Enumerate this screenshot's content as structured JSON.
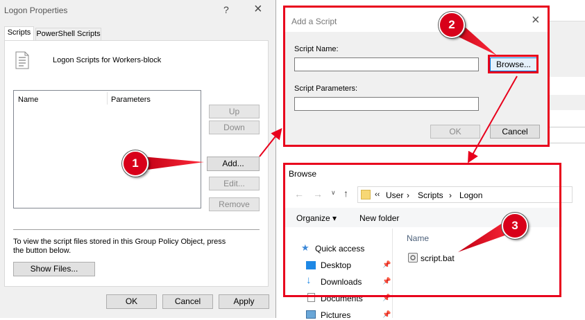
{
  "logon": {
    "title": "Logon Properties",
    "help": "?",
    "close": "×",
    "tabs": [
      "Scripts",
      "PowerShell Scripts"
    ],
    "heading": "Logon Scripts for Workers-block",
    "columns": [
      "Name",
      "Parameters"
    ],
    "buttons": {
      "up": "Up",
      "down": "Down",
      "add": "Add...",
      "edit": "Edit...",
      "remove": "Remove"
    },
    "info": "To view the script files stored in this Group Policy Object, press the button below.",
    "show_files": "Show Files...",
    "ok": "OK",
    "cancel": "Cancel",
    "apply": "Apply"
  },
  "add_script": {
    "title": "Add a Script",
    "close": "×",
    "name_label": "Script Name:",
    "name_value": "",
    "browse": "Browse...",
    "params_label": "Script Parameters:",
    "params_value": "",
    "ok": "OK",
    "cancel": "Cancel"
  },
  "browse": {
    "title": "Browse",
    "breadcrumb": [
      "‹‹",
      "User",
      "›",
      "Scripts",
      "›",
      "Logon"
    ],
    "organize": "Organize ▾",
    "new_folder": "New folder",
    "column_name": "Name",
    "nav": [
      "Quick access",
      "Desktop",
      "Downloads",
      "Documents",
      "Pictures"
    ],
    "file": "script.bat"
  },
  "badges": [
    "1",
    "2",
    "3"
  ],
  "colors": {
    "annotation_red": "#e8001c",
    "accent_blue": "#0078d7"
  }
}
